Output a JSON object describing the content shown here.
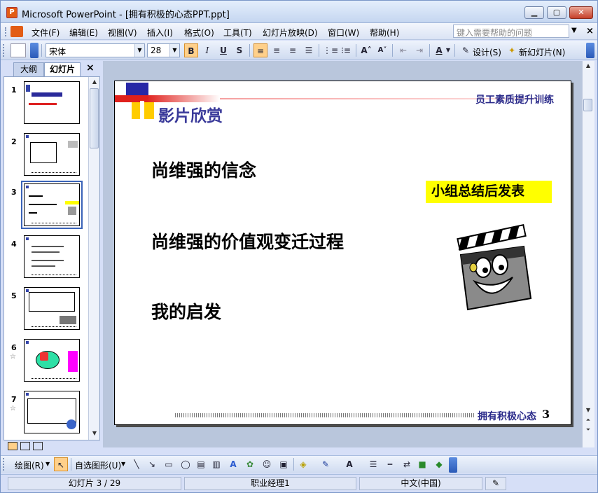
{
  "window": {
    "title": "Microsoft PowerPoint - [拥有积极的心态PPT.ppt]",
    "app_icon": "P"
  },
  "menu": {
    "items": [
      "文件(F)",
      "编辑(E)",
      "视图(V)",
      "插入(I)",
      "格式(O)",
      "工具(T)",
      "幻灯片放映(D)",
      "窗口(W)",
      "帮助(H)"
    ],
    "help_placeholder": "键入需要帮助的问题"
  },
  "toolbar": {
    "font_name": "宋体",
    "font_size": "28",
    "bold": "B",
    "italic": "I",
    "underline": "U",
    "shadow": "S",
    "design_label": "设计(S)",
    "new_slide_label": "新幻灯片(N)"
  },
  "pane": {
    "tab_outline": "大纲",
    "tab_slides": "幻灯片",
    "close": "×",
    "thumb_numbers": [
      "1",
      "2",
      "3",
      "4",
      "5",
      "6",
      "7"
    ],
    "star": "☆"
  },
  "slide": {
    "header_right": "员工素质提升训练",
    "title": "影片欣赏",
    "line1": "尚维强的信念",
    "line2": "尚维强的价值观变迁过程",
    "line3": "我的启发",
    "note": "小组总结后发表",
    "footer_text": "拥有积极心态",
    "page_number": "3",
    "note_bg": "#ffff00",
    "title_color": "#3a3a9a",
    "accent_red": "#e0201c"
  },
  "drawbar": {
    "draw_label": "绘图(R)",
    "autoshape_label": "自选图形(U)"
  },
  "status": {
    "slide_info": "幻灯片 3 / 29",
    "design": "职业经理1",
    "language": "中文(中国)"
  }
}
